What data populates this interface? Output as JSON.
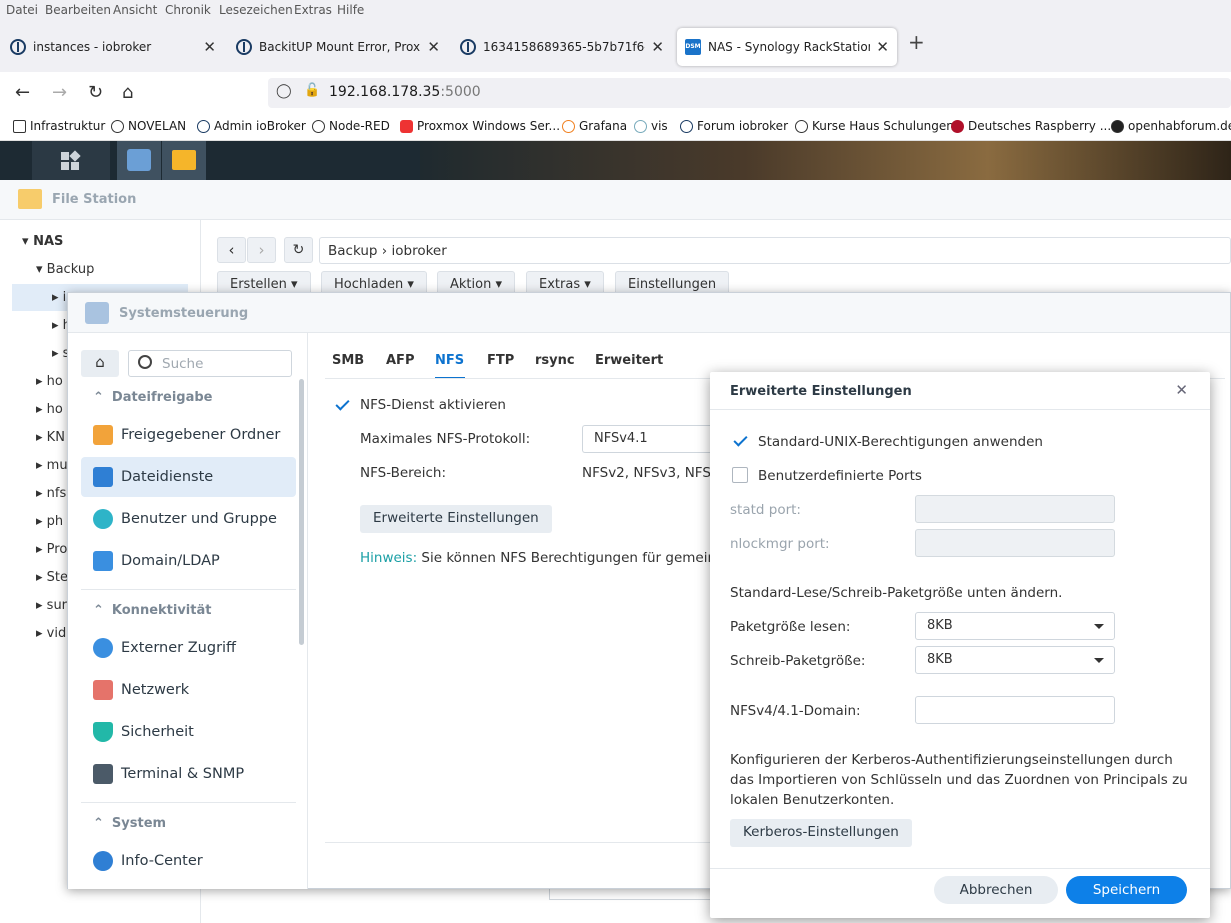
{
  "menubar": {
    "items": [
      "Datei",
      "Bearbeiten",
      "Ansicht",
      "Chronik",
      "Lesezeichen",
      "Extras",
      "Hilfe"
    ]
  },
  "tabs": [
    {
      "label": "instances - iobroker",
      "close": "✕"
    },
    {
      "label": "BackitUP Mount Error, Proxmox",
      "close": "✕"
    },
    {
      "label": "1634158689365-5b7b71f6-e8dc",
      "close": "✕"
    },
    {
      "label": "NAS - Synology RackStation",
      "close": "✕",
      "icon_text": "DSM"
    }
  ],
  "newtab": "+",
  "address": {
    "host": "192.168.178.35",
    "port": ":5000"
  },
  "bookmarks": [
    "Infrastruktur",
    "NOVELAN",
    "Admin ioBroker",
    "Node-RED",
    "Proxmox Windows Ser...",
    "Grafana",
    "vis",
    "Forum iobroker",
    "Kurse Haus Schulungen",
    "Deutsches Raspberry ...",
    "openhabforum.de"
  ],
  "filestation": {
    "title": "File Station",
    "tree": {
      "root": "NAS",
      "backup": "Backup",
      "sub": [
        "i",
        "h",
        "s"
      ],
      "items": [
        "ho",
        "ho",
        "KN",
        "mu",
        "nfs",
        "ph",
        "Pro",
        "Ste",
        "sur",
        "vid"
      ]
    },
    "breadcrumb": [
      "Backup",
      "iobroker"
    ],
    "toolbar": [
      "Erstellen",
      "Hochladen",
      "Aktion",
      "Extras",
      "Einstellungen"
    ]
  },
  "sysctl": {
    "title": "Systemsteuerung",
    "search_placeholder": "Suche",
    "groups": [
      {
        "title": "Dateifreigabe",
        "items": [
          "Freigegebener Ordner",
          "Dateidienste",
          "Benutzer und Gruppe",
          "Domain/LDAP"
        ]
      },
      {
        "title": "Konnektivität",
        "items": [
          "Externer Zugriff",
          "Netzwerk",
          "Sicherheit",
          "Terminal & SNMP"
        ]
      },
      {
        "title": "System",
        "items": [
          "Info-Center"
        ]
      }
    ],
    "tabs": [
      "SMB",
      "AFP",
      "NFS",
      "FTP",
      "rsync",
      "Erweitert"
    ],
    "nfs": {
      "enable_label": "NFS-Dienst aktivieren",
      "max_proto_label": "Maximales NFS-Protokoll:",
      "max_proto_value": "NFSv4.1",
      "range_label": "NFS-Bereich:",
      "range_value": "NFSv2, NFSv3, NFS",
      "adv_button": "Erweiterte Einstellungen",
      "hint_prefix": "Hinweis:",
      "hint_text": " Sie können NFS Berechtigungen für gemeins"
    }
  },
  "dialog": {
    "title": "Erweiterte Einstellungen",
    "close": "✕",
    "unix_perm": "Standard-UNIX-Berechtigungen anwenden",
    "custom_ports": "Benutzerdefinierte Ports",
    "statd": "statd port:",
    "nlockmgr": "nlockmgr port:",
    "packet_heading": "Standard-Lese/Schreib-Paketgröße unten ändern.",
    "read_label": "Paketgröße lesen:",
    "read_value": "8KB",
    "write_label": "Schreib-Paketgröße:",
    "write_value": "8KB",
    "domain_label": "NFSv4/4.1-Domain:",
    "kerberos_text": "Konfigurieren der Kerberos-Authentifizierungseinstellungen durch das Importieren von Schlüsseln und das Zuordnen von Principals zu lokalen Benutzerkonten.",
    "kerberos_button": "Kerberos-Einstellungen",
    "cancel": "Abbrechen",
    "save": "Speichern"
  },
  "colors": {
    "accent": "#0d73cf",
    "primary_button": "#0d80e8",
    "hint": "#1a9fa5"
  }
}
